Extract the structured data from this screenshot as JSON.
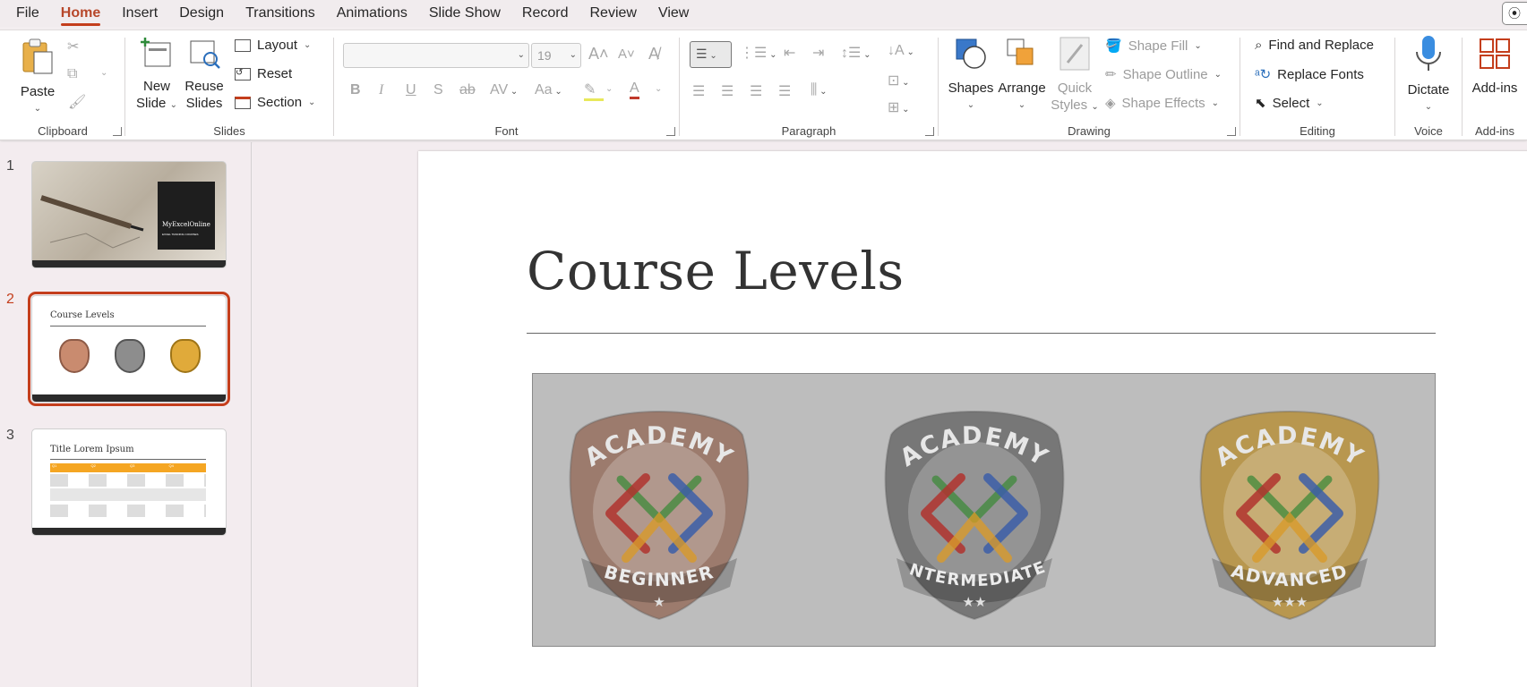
{
  "menu": {
    "tabs": [
      "File",
      "Home",
      "Insert",
      "Design",
      "Transitions",
      "Animations",
      "Slide Show",
      "Record",
      "Review",
      "View"
    ],
    "active": "Home"
  },
  "ribbon": {
    "clipboard": {
      "paste": "Paste",
      "label": "Clipboard"
    },
    "slides": {
      "new_slide_1": "New",
      "new_slide_2": "Slide",
      "reuse_1": "Reuse",
      "reuse_2": "Slides",
      "layout": "Layout",
      "reset": "Reset",
      "section": "Section",
      "label": "Slides"
    },
    "font": {
      "size": "19",
      "label": "Font"
    },
    "paragraph": {
      "label": "Paragraph"
    },
    "drawing": {
      "shapes": "Shapes",
      "arrange": "Arrange",
      "quick_1": "Quick",
      "quick_2": "Styles",
      "shape_fill": "Shape Fill",
      "shape_outline": "Shape Outline",
      "shape_effects": "Shape Effects",
      "label": "Drawing"
    },
    "editing": {
      "find_replace": "Find and Replace",
      "replace_fonts": "Replace Fonts",
      "select": "Select",
      "label": "Editing"
    },
    "voice": {
      "dictate": "Dictate",
      "label": "Voice"
    },
    "addins": {
      "addins": "Add-ins",
      "label": "Add-ins"
    }
  },
  "thumbnails": [
    {
      "number": "1",
      "title": "MyExcelOnline",
      "subtitle": "EXCEL TRAINING COURSES"
    },
    {
      "number": "2",
      "title": "Course Levels",
      "selected": true
    },
    {
      "number": "3",
      "title": "Title Lorem Ipsum",
      "columns": [
        "Q1",
        "Q2",
        "Q3",
        "Q4"
      ]
    }
  ],
  "slide": {
    "title": "Course Levels",
    "badges": [
      {
        "top": "ACADEMY",
        "level": "BEGINNER",
        "stars": "★",
        "color": "#9c7b6d"
      },
      {
        "top": "ACADEMY",
        "level": "INTERMEDIATE",
        "stars": "★★",
        "color": "#777777"
      },
      {
        "top": "ACADEMY",
        "level": "ADVANCED",
        "stars": "★★★",
        "color": "#b8974f"
      }
    ]
  },
  "colors": {
    "accent": "#c43e1c",
    "badge_panel": "#bdbdbd"
  }
}
